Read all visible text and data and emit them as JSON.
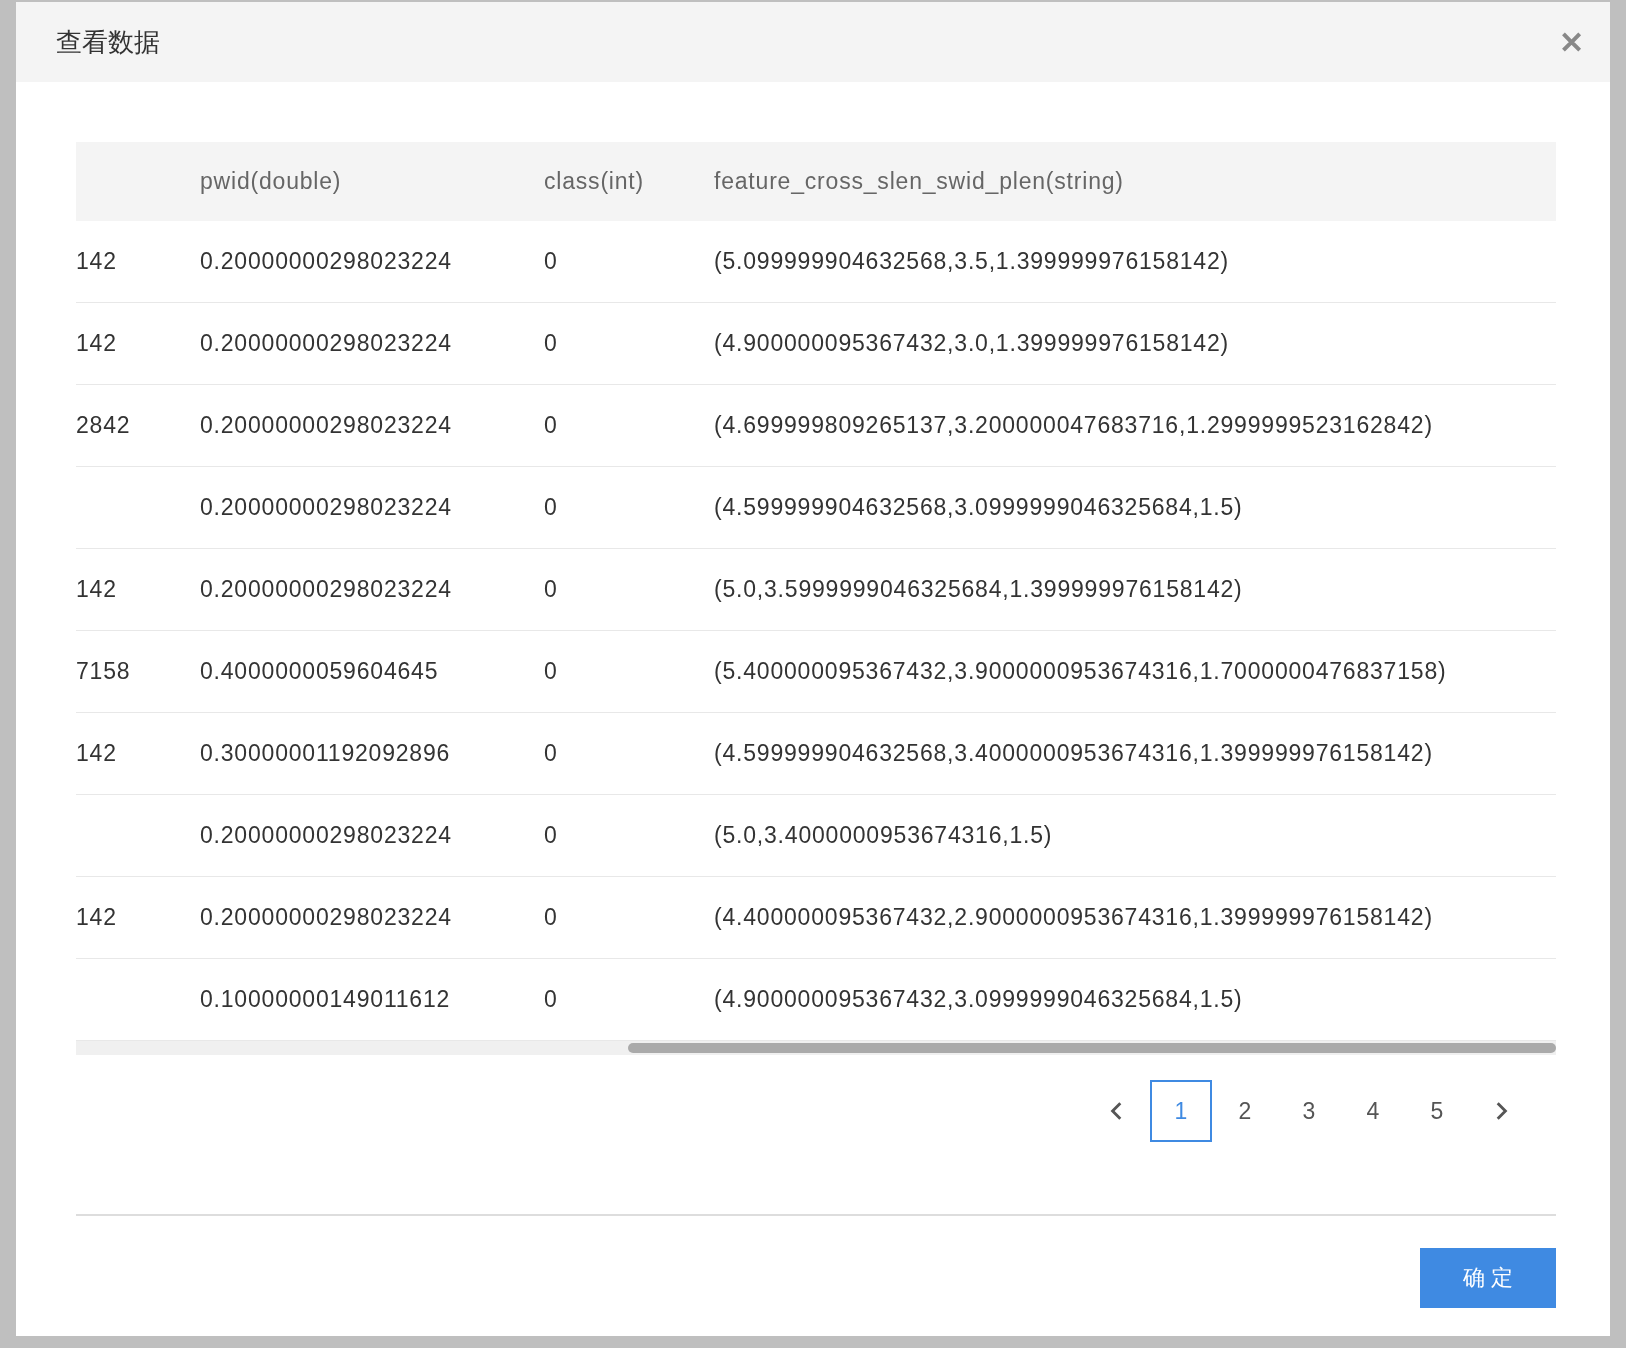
{
  "dialog": {
    "title": "查看数据",
    "close": "✕"
  },
  "table": {
    "columns": [
      "pwid(double)",
      "class(int)",
      "feature_cross_slen_swid_plen(string)"
    ],
    "rows": [
      {
        "column_1": "142",
        "pwid": "0.20000000298023224",
        "class": "0",
        "feature": "(5.099999904632568,3.5,1.399999976158142)"
      },
      {
        "column_1": "142",
        "pwid": "0.20000000298023224",
        "class": "0",
        "feature": "(4.900000095367432,3.0,1.399999976158142)"
      },
      {
        "column_1": "2842",
        "pwid": "0.20000000298023224",
        "class": "0",
        "feature": "(4.699999809265137,3.200000047683716,1.2999999523162842)"
      },
      {
        "pwid": "0.20000000298023224",
        "class": "0",
        "feature": "(4.599999904632568,3.0999999046325684,1.5)"
      },
      {
        "column_1": "142",
        "pwid": "0.20000000298023224",
        "class": "0",
        "feature": "(5.0,3.5999999046325684,1.399999976158142)"
      },
      {
        "column_1": "7158",
        "pwid": "0.4000000059604645",
        "class": "0",
        "feature": "(5.400000095367432,3.9000000953674316,1.7000000476837158)"
      },
      {
        "column_1": "142",
        "pwid": "0.30000001192092896",
        "class": "0",
        "feature": "(4.599999904632568,3.4000000953674316,1.399999976158142)"
      },
      {
        "pwid": "0.20000000298023224",
        "class": "0",
        "feature": "(5.0,3.4000000953674316,1.5)"
      },
      {
        "column_1": "142",
        "pwid": "0.20000000298023224",
        "class": "0",
        "feature": "(4.400000095367432,2.9000000953674316,1.399999976158142)"
      },
      {
        "pwid": "0.10000000149011612",
        "class": "0",
        "feature": "(4.900000095367432,3.0999999046325684,1.5)"
      }
    ]
  },
  "pagination": {
    "pages": [
      {
        "label": "1",
        "selected": true
      },
      {
        "label": "2",
        "selected": false
      },
      {
        "label": "3",
        "selected": false
      },
      {
        "label": "4",
        "selected": false
      },
      {
        "label": "5",
        "selected": false
      }
    ]
  },
  "buttons": [
    "确 定"
  ]
}
